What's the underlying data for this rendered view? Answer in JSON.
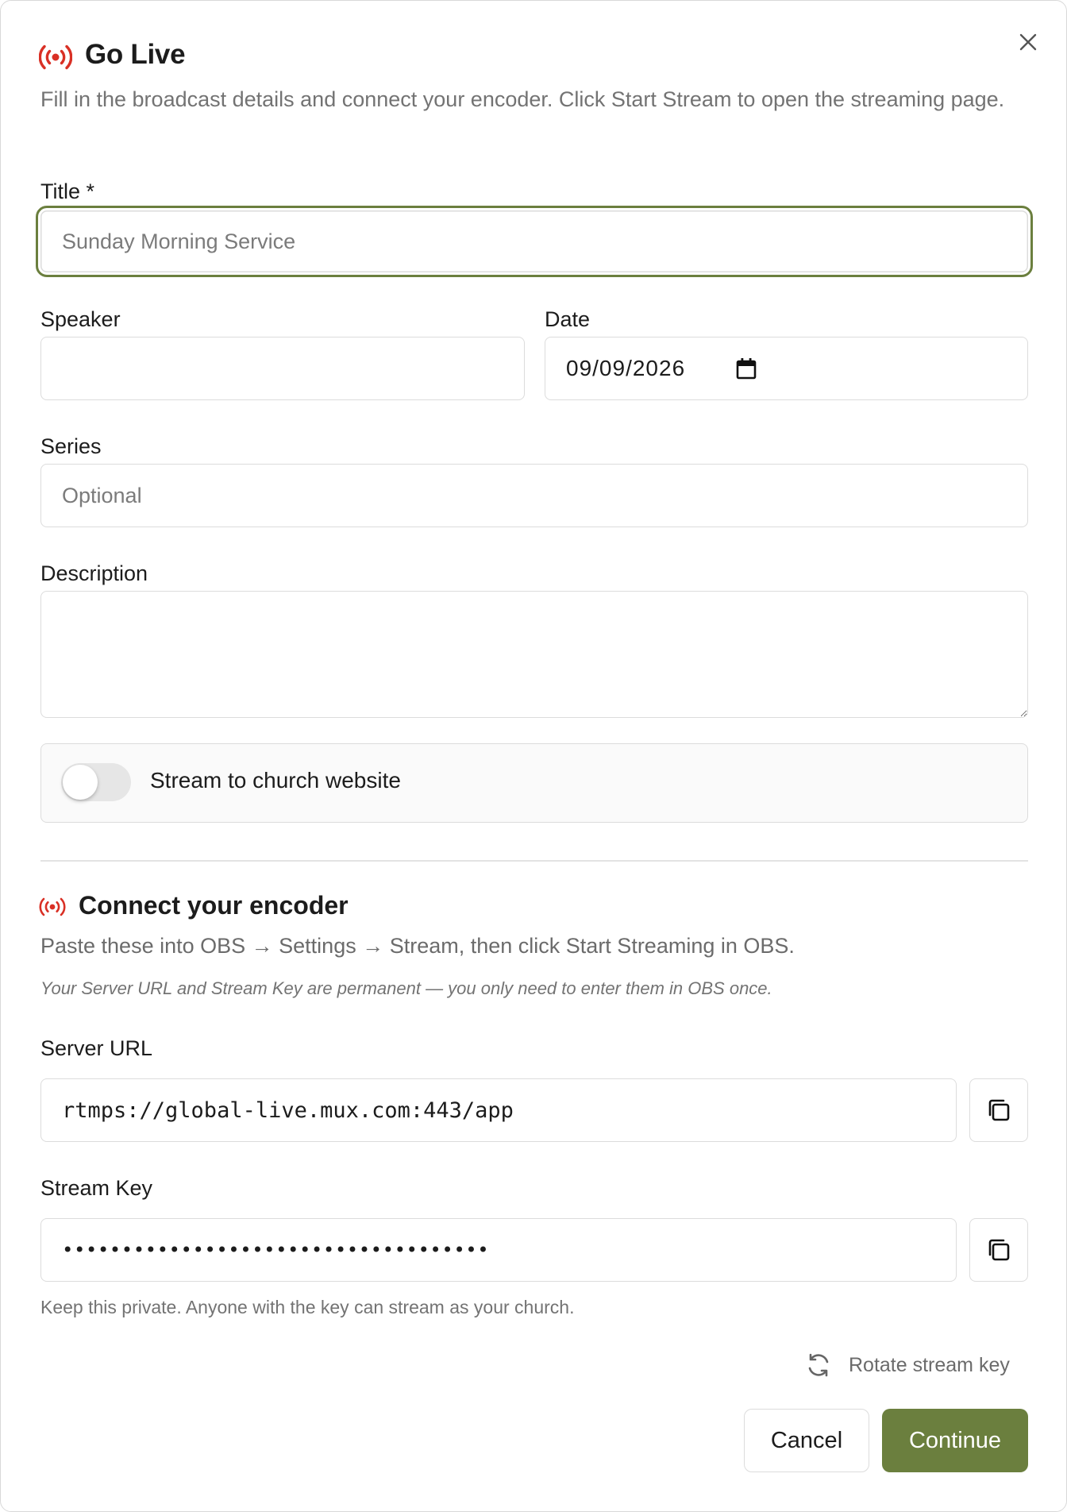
{
  "dialog": {
    "title": "Go Live",
    "subtitle": "Fill in the broadcast details and connect your encoder. Click Start Stream to open the streaming page."
  },
  "form": {
    "title_label": "Title *",
    "title_placeholder": "Sunday Morning Service",
    "speaker_label": "Speaker",
    "date_label": "Date",
    "date_value": "09/09/2026",
    "series_label": "Series",
    "series_placeholder": "Optional",
    "description_label": "Description",
    "stream_toggle_label": "Stream to church website",
    "stream_toggle_on": false
  },
  "encoder": {
    "heading": "Connect your encoder",
    "instructions": "Paste these into OBS → Settings → Stream, then click Start Streaming in OBS.",
    "note": "Your Server URL and Stream Key are permanent — you only need to enter them in OBS once.",
    "server_url_label": "Server URL",
    "server_url_value": "rtmps://global-live.mux.com:443/app",
    "stream_key_label": "Stream Key",
    "stream_key_masked": "••••••••••••••••••••••••••••••••••••",
    "stream_key_help": "Keep this private. Anyone with the key can stream as your church.",
    "rotate_label": "Rotate stream key"
  },
  "footer": {
    "cancel_label": "Cancel",
    "continue_label": "Continue"
  },
  "colors": {
    "accent": "#6b7f3e",
    "live_icon": "#d93025"
  },
  "icons": {
    "header": "broadcast-icon",
    "close": "close-icon",
    "calendar": "calendar-icon",
    "copy": "copy-icon",
    "rotate": "refresh-icon"
  }
}
